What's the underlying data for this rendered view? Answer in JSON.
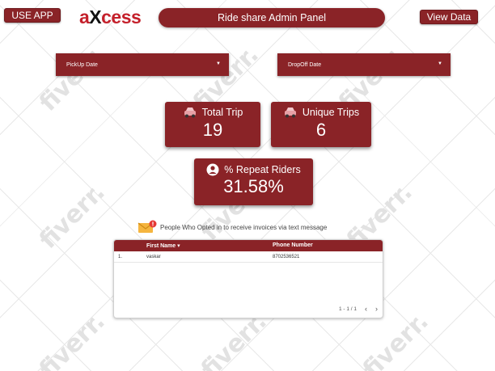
{
  "header": {
    "use_app_label": "USE APP",
    "logo": {
      "text": "aXcess"
    },
    "title": "Ride share Admin Panel",
    "view_data_label": "View Data"
  },
  "filters": {
    "pickup_label": "PickUp Date",
    "dropoff_label": "DropOff Date"
  },
  "kpis": {
    "total_trip": {
      "label": "Total Trip",
      "value": "19"
    },
    "unique_trips": {
      "label": "Unique Trips",
      "value": "6"
    },
    "repeat_riders": {
      "label": "% Repeat Riders",
      "value": "31.58%"
    }
  },
  "notice": {
    "text": "People Who Opted in to receive invoices via text message"
  },
  "table": {
    "columns": [
      "First Name",
      "Phone Number"
    ],
    "sort_indicator": "▾",
    "rows": [
      {
        "index": "1.",
        "first_name": "vaskar",
        "phone": "8702536521"
      }
    ],
    "pagination": "1 - 1 / 1",
    "prev": "‹",
    "next": "›"
  },
  "watermark": "fiverr.",
  "colors": {
    "primary": "#8a2327",
    "logo_red": "#c4202b",
    "background": "#ffffff"
  },
  "icons": {
    "car": "car-icon",
    "person": "person-icon",
    "mail": "mail-notification-icon",
    "dropdown": "chevron-down-icon"
  }
}
